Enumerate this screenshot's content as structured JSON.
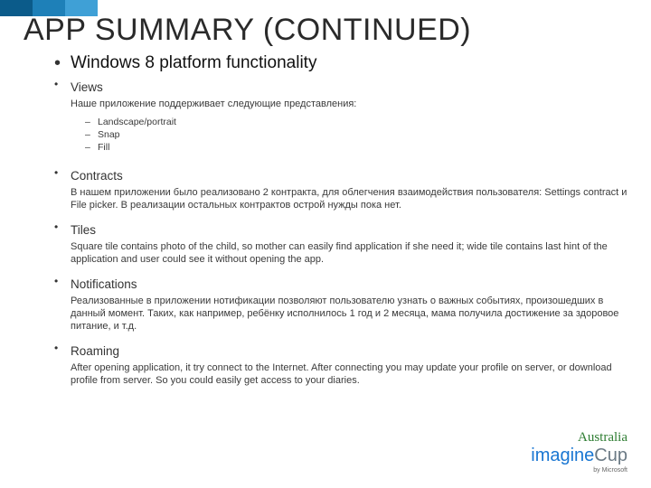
{
  "title": "APP SUMMARY (CONTINUED)",
  "main_heading": "Windows 8 platform functionality",
  "sections": [
    {
      "heading": "Views",
      "body": "Наше приложение поддерживает следующие представления:",
      "items": [
        "Landscape/portrait",
        "Snap",
        "Fill"
      ]
    },
    {
      "heading": "Contracts",
      "body": "В нашем приложении было реализовано 2 контракта, для облегчения взаимодействия пользователя: Settings contract и File picker. В реализации остальных контрактов острой нужды пока нет."
    },
    {
      "heading": "Tiles",
      "body": "Square tile  contains photo of the child, so mother can easily find application if she need it; wide tile contains last hint  of the application and user could see it without opening the app."
    },
    {
      "heading": "Notifications",
      "body": "Реализованные в приложении нотификации позволяют пользователю узнать о важных событиях, произошедших в данный момент. Таких, как например, ребёнку исполнилось 1 год и 2 месяца, мама получила достижение за здоровое питание, и т.д."
    },
    {
      "heading": "Roaming",
      "body": "After opening application, it try connect to the Internet. After connecting you may update your profile on server, or download profile from server. So you could easily get access to your diaries."
    }
  ],
  "logo": {
    "australia": "Australia",
    "imagine": "imagine",
    "cup": "Cup",
    "sub": "by Microsoft"
  }
}
